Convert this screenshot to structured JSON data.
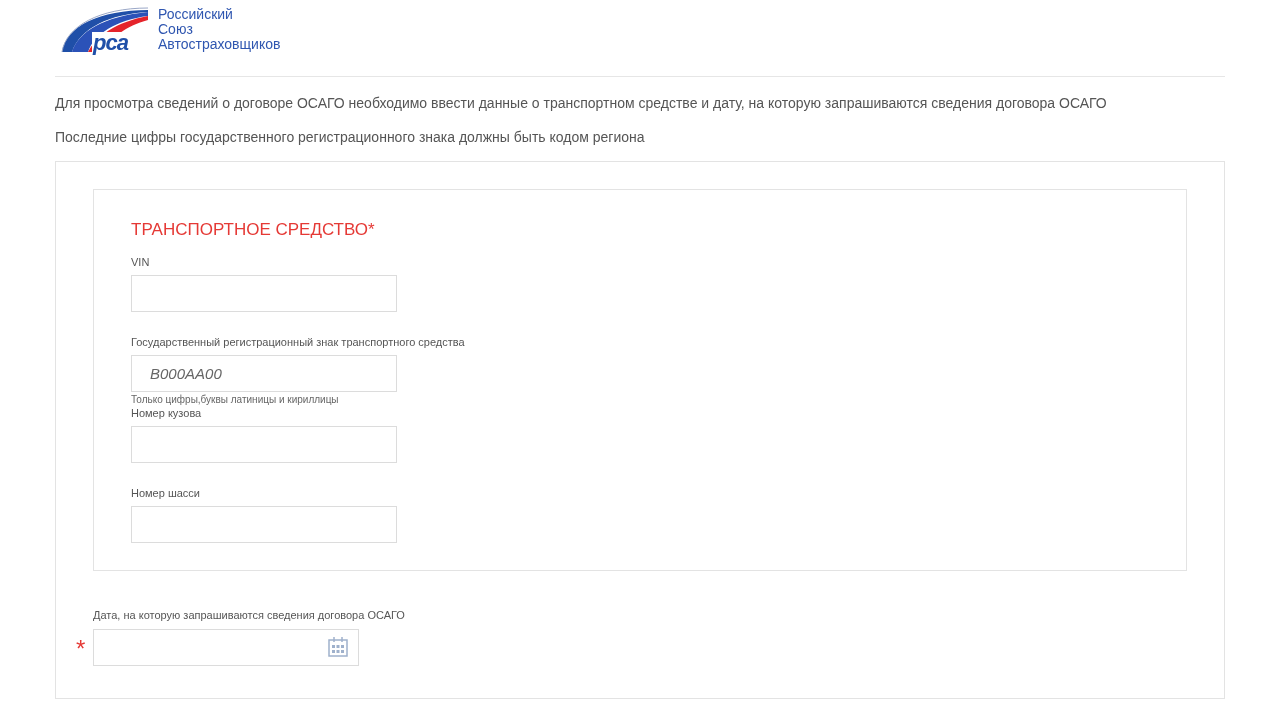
{
  "logo": {
    "mark": "рса",
    "lines": [
      "Российский",
      "Союз",
      "Автостраховщиков"
    ]
  },
  "intro": [
    "Для просмотра сведений о договоре ОСАГО необходимо ввести данные о транспортном средстве и дату, на которую запрашиваются сведения договора ОСАГО",
    "Последние цифры государственного регистрационного знака должны быть кодом региона"
  ],
  "vehicle": {
    "title": "ТРАНСПОРТНОЕ СРЕДСТВО*",
    "fields": [
      {
        "label": "VIN"
      },
      {
        "label": "Государственный регистрационный знак транспортного средства",
        "placeholder": "В000АА00",
        "hint": "Только цифры,буквы латиницы и кириллицы"
      },
      {
        "label": "Номер кузова"
      },
      {
        "label": "Номер шасси"
      }
    ]
  },
  "date_field": {
    "label": "Дата, на которую запрашиваются сведения договора ОСАГО",
    "required": true,
    "required_mark": "*"
  }
}
